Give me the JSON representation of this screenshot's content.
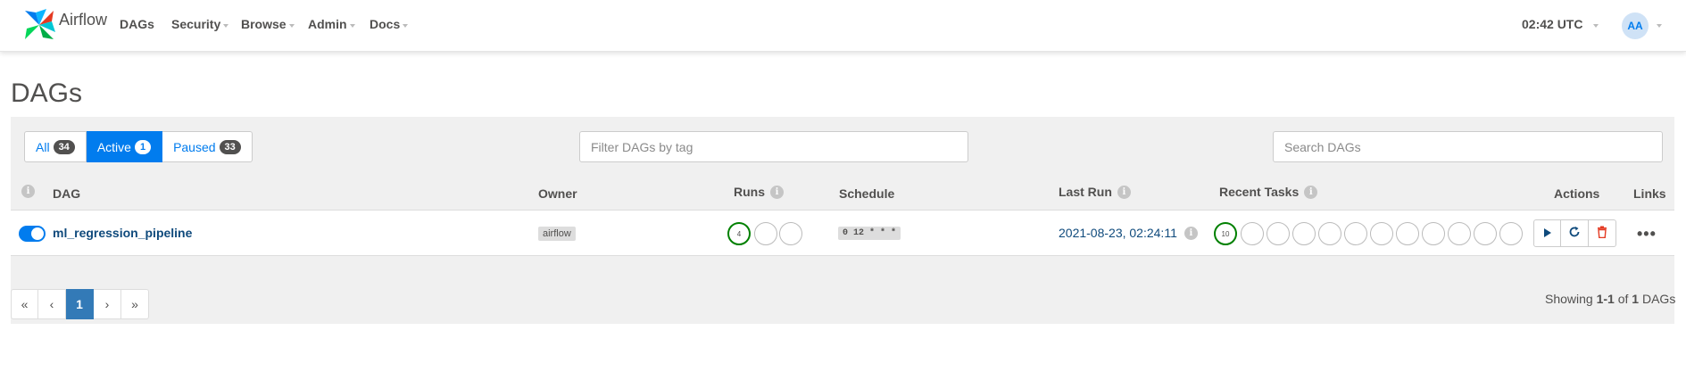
{
  "brand": {
    "name": "Airflow",
    "logo_icon": "airflow-pinwheel-icon"
  },
  "nav": {
    "items": [
      {
        "label": "DAGs",
        "dropdown": false
      },
      {
        "label": "Security",
        "dropdown": true
      },
      {
        "label": "Browse",
        "dropdown": true
      },
      {
        "label": "Admin",
        "dropdown": true
      },
      {
        "label": "Docs",
        "dropdown": true
      }
    ],
    "clock": "02:42 UTC",
    "user_initials": "AA"
  },
  "page": {
    "title": "DAGs"
  },
  "filters": {
    "tabs": [
      {
        "label": "All",
        "count": "34",
        "active": false
      },
      {
        "label": "Active",
        "count": "1",
        "active": true
      },
      {
        "label": "Paused",
        "count": "33",
        "active": false
      }
    ],
    "tag_placeholder": "Filter DAGs by tag",
    "search_placeholder": "Search DAGs"
  },
  "table": {
    "headers": {
      "dag": "DAG",
      "owner": "Owner",
      "runs": "Runs",
      "schedule": "Schedule",
      "last_run": "Last Run",
      "recent_tasks": "Recent Tasks",
      "actions": "Actions",
      "links": "Links"
    },
    "rows": [
      {
        "active": true,
        "dag_id": "ml_regression_pipeline",
        "owner": "airflow",
        "runs": [
          "4",
          "",
          ""
        ],
        "schedule": "0 12 * * *",
        "last_run": "2021-08-23, 02:24:11",
        "recent_tasks": [
          "10",
          "",
          "",
          "",
          "",
          "",
          "",
          "",
          "",
          "",
          "",
          ""
        ],
        "actions": [
          "trigger-dag-icon",
          "refresh-icon",
          "delete-icon"
        ],
        "links_icon": "more-horizontal-icon"
      }
    ]
  },
  "pagination": {
    "first": "«",
    "prev": "‹",
    "current": "1",
    "next": "›",
    "last": "»",
    "showing_prefix": "Showing",
    "showing_range": "1-1",
    "showing_of": "of",
    "showing_total": "1",
    "showing_suffix": "DAGs"
  },
  "colors": {
    "accent": "#017cee",
    "success": "#008000",
    "dag_link": "#0f4a7c",
    "delete": "#e43921"
  }
}
